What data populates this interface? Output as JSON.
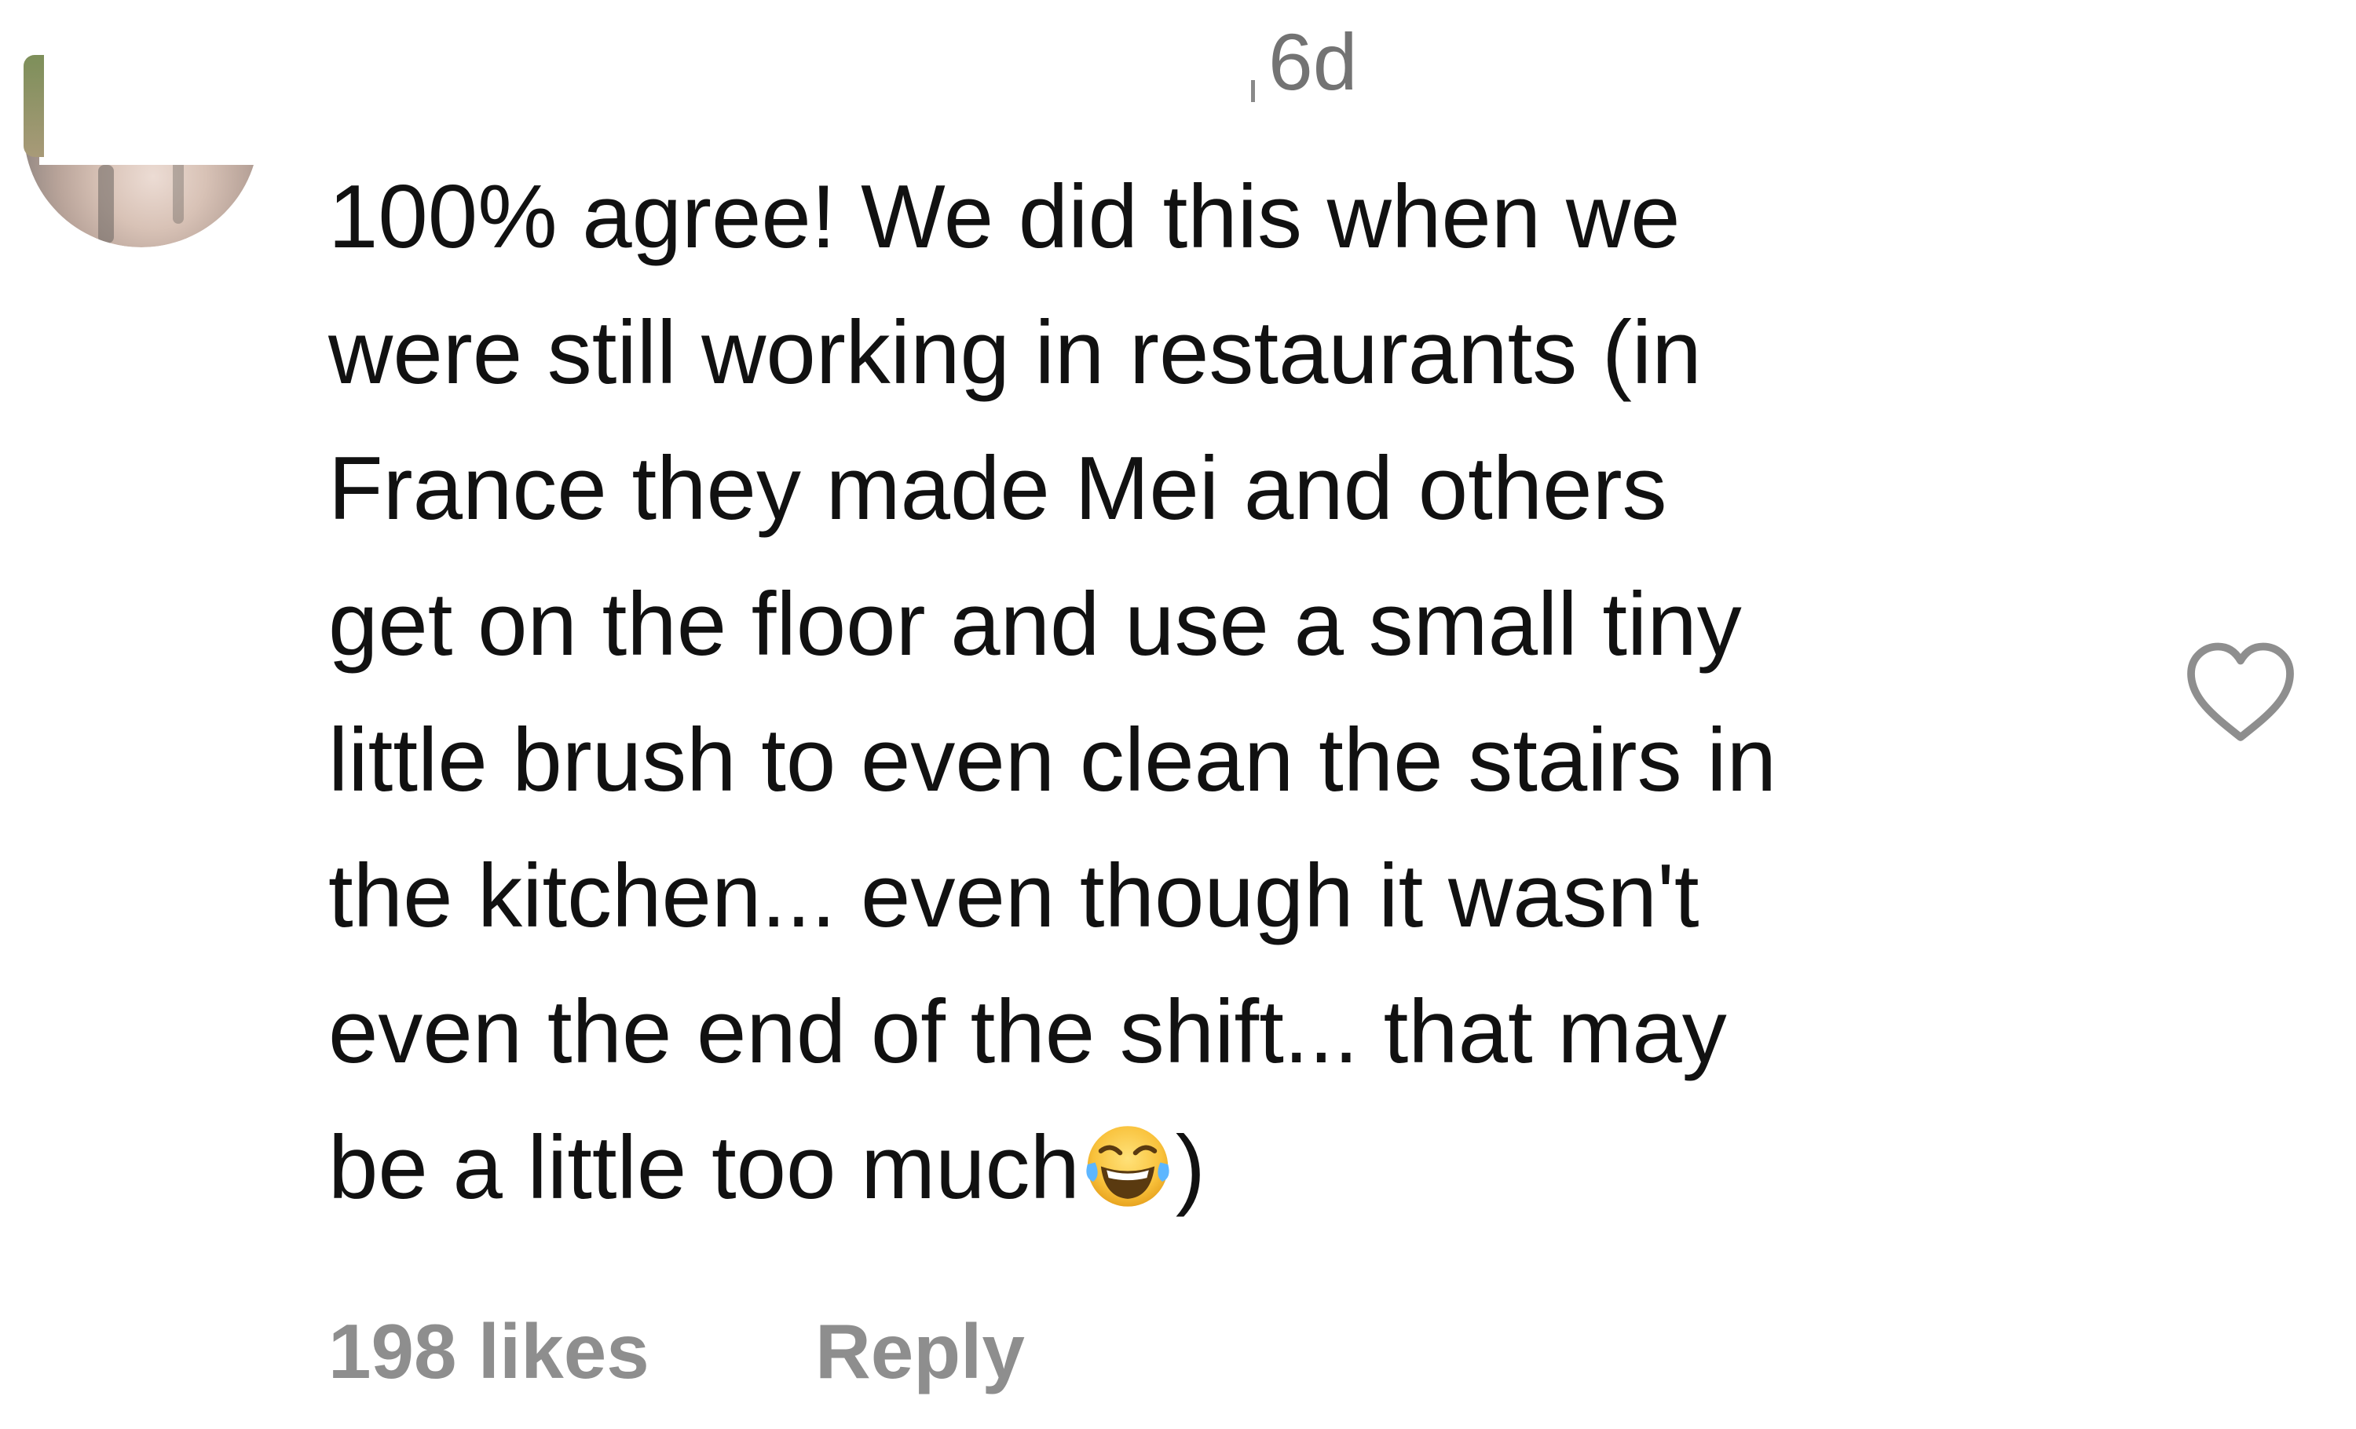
{
  "comment": {
    "timestamp": "6d",
    "text": "100% agree! We did this when we\nwere still working in restaurants (in\nFrance they made Mei and others\nget on the floor and use a small tiny\nlittle brush to even clean the stairs in\nthe kitchen... even though it wasn't\neven the end of the shift... that may\nbe a little too much",
    "text_end": ")",
    "emoji": "face-with-tears-of-joy-emoji",
    "likes_label": "198 likes",
    "reply_label": "Reply",
    "like_icon": "heart-outline-icon"
  },
  "colors": {
    "text": "#111111",
    "meta": "#8e8e8e",
    "timestamp": "#737373",
    "heart_stroke": "#8e8e8e"
  }
}
